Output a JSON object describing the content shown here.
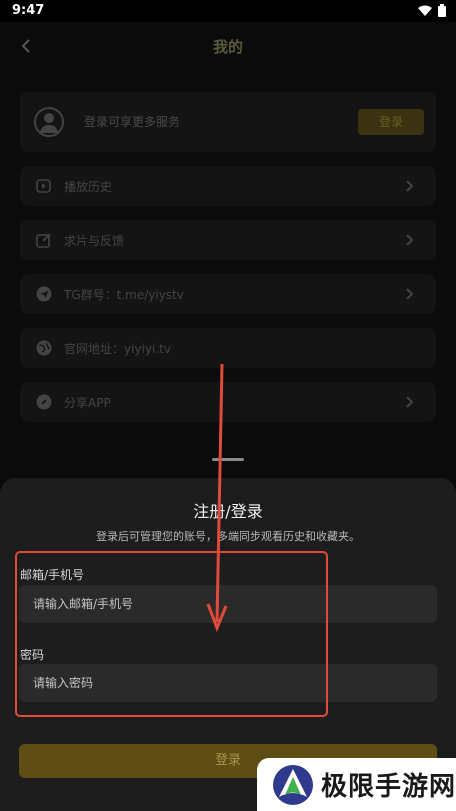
{
  "status_bar": {
    "time": "9:47"
  },
  "header": {
    "title": "我的"
  },
  "login_card": {
    "hint": "登录可享更多服务",
    "button": "登录"
  },
  "menu": [
    {
      "label": "播放历史",
      "icon": "play-history-icon",
      "chevron": true
    },
    {
      "label": "求片与反馈",
      "icon": "edit-icon",
      "chevron": true
    },
    {
      "label": "TG群号：t.me/yiystv",
      "icon": "telegram-icon",
      "chevron": true
    },
    {
      "label": "官网地址：yiyiyi.tv",
      "icon": "globe-icon",
      "chevron": false
    },
    {
      "label": "分享APP",
      "icon": "compass-icon",
      "chevron": true
    }
  ],
  "sheet": {
    "title": "注册/登录",
    "subtitle": "登录后可管理您的账号，多端同步观看历史和收藏夹。",
    "email_label": "邮箱/手机号",
    "email_placeholder": "请输入邮箱/手机号",
    "password_label": "密码",
    "password_placeholder": "请输入密码",
    "submit": "登录"
  },
  "watermark": {
    "text": "极限手游网"
  },
  "colors": {
    "accent": "#5e4e14",
    "annotation": "#e04a3a"
  }
}
